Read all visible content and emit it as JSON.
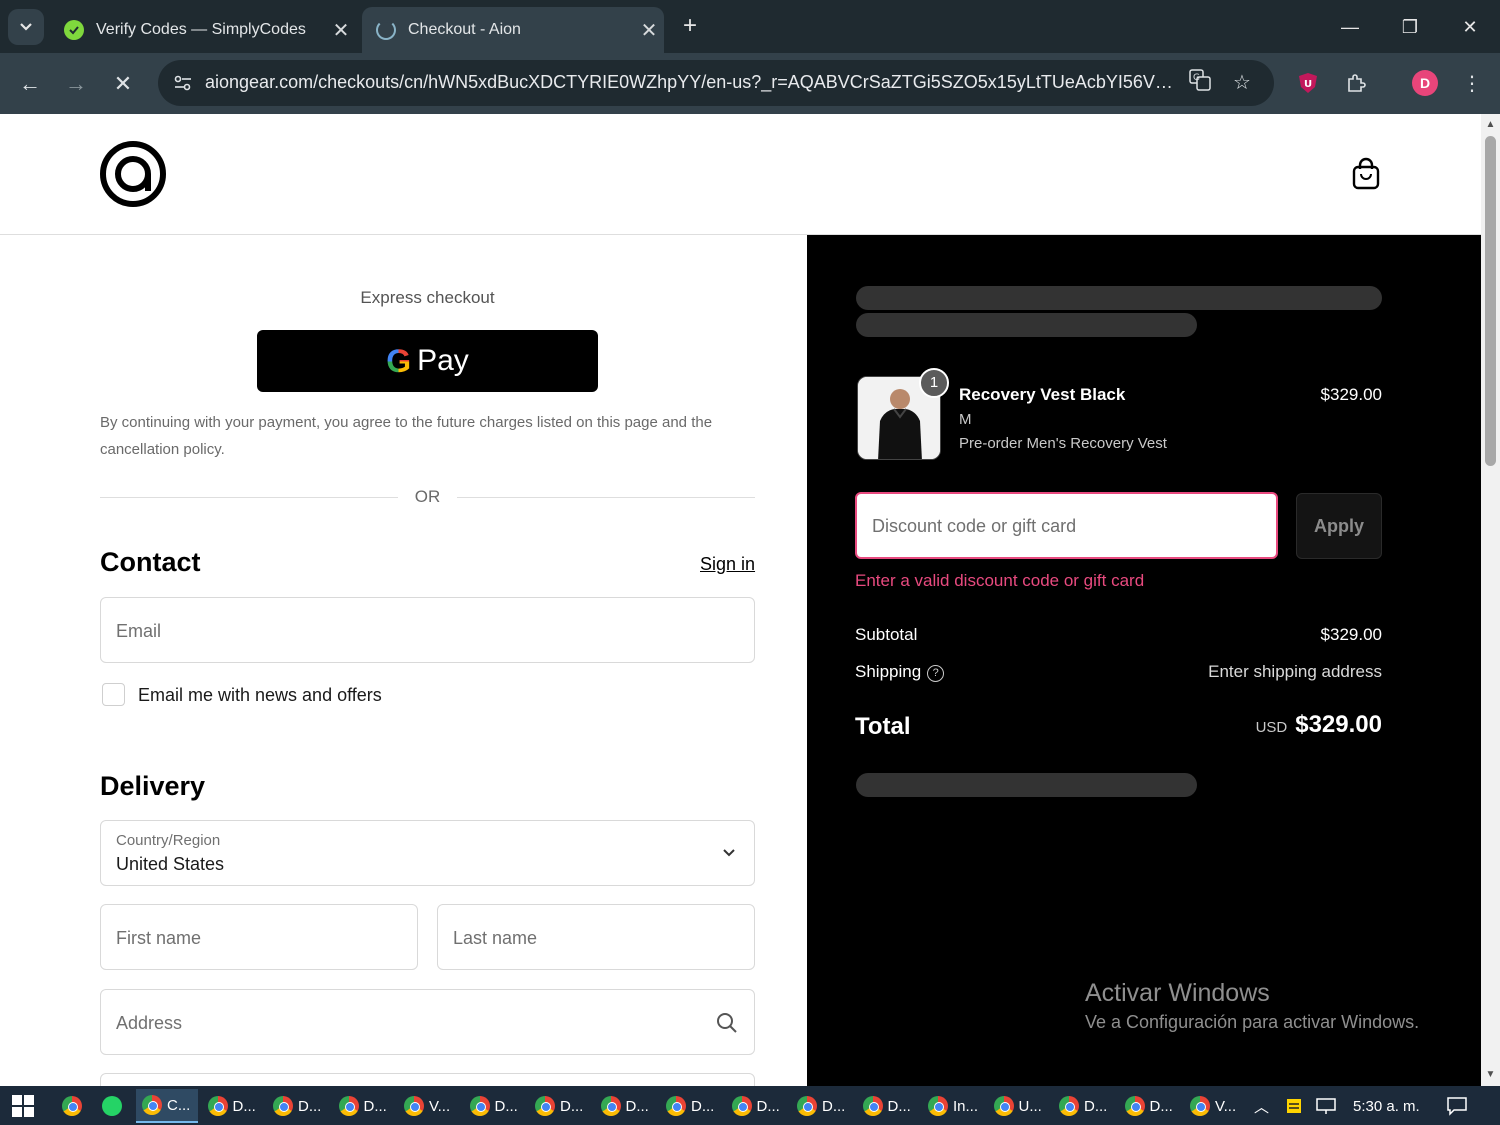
{
  "browser": {
    "tabs": [
      {
        "title": "Verify Codes — SimplyCodes",
        "active": false
      },
      {
        "title": "Checkout - Aion",
        "active": true
      }
    ],
    "new_tab_glyph": "+",
    "url": "aiongear.com/checkouts/cn/hWN5xdBucXDCTYRIE0WZhpYY/en-us?_r=AQABVCrSaZTGi5SZO5x15yLtTUeAcbYI56VTnn...",
    "profile_initial": "D",
    "colors": {
      "profile": "#e8457a",
      "chrome_bg": "#1f2a30",
      "toolbar_bg": "#33414a"
    }
  },
  "header": {
    "logo_icon": "aion-logo-icon",
    "cart_icon": "shopping-bag-icon"
  },
  "express": {
    "title": "Express checkout",
    "gpay_g": "G",
    "gpay_label": "Pay",
    "legal_text": "By continuing with your payment, you agree to the future charges listed on this page and the cancellation policy.",
    "or_label": "OR"
  },
  "contact": {
    "title": "Contact",
    "signin_label": "Sign in",
    "email_placeholder": "Email",
    "newsletter_label": "Email me with news and offers",
    "newsletter_checked": false
  },
  "delivery": {
    "title": "Delivery",
    "country_label": "Country/Region",
    "country_value": "United States",
    "first_name_placeholder": "First name",
    "last_name_placeholder": "Last name",
    "address_placeholder": "Address"
  },
  "summary": {
    "item": {
      "quantity": "1",
      "title": "Recovery Vest Black",
      "variant": "M",
      "description": "Pre-order Men's Recovery Vest",
      "price": "$329.00"
    },
    "discount_placeholder": "Discount code or gift card",
    "apply_label": "Apply",
    "discount_error": "Enter a valid discount code or gift card",
    "subtotal_label": "Subtotal",
    "subtotal_value": "$329.00",
    "shipping_label": "Shipping",
    "shipping_help_glyph": "?",
    "shipping_value": "Enter shipping address",
    "total_label": "Total",
    "total_currency": "USD",
    "total_value": "$329.00",
    "colors": {
      "error": "#e84a7f",
      "panel_bg": "#000000"
    }
  },
  "watermark": {
    "title": "Activar Windows",
    "subtitle": "Ve a Configuración para activar Windows."
  },
  "taskbar": {
    "items": [
      "C...",
      "D...",
      "D...",
      "D...",
      "V...",
      "D...",
      "D...",
      "D...",
      "D...",
      "D...",
      "D...",
      "D...",
      "In...",
      "U...",
      "D...",
      "D...",
      "V..."
    ],
    "clock": "5:30 a. m."
  }
}
